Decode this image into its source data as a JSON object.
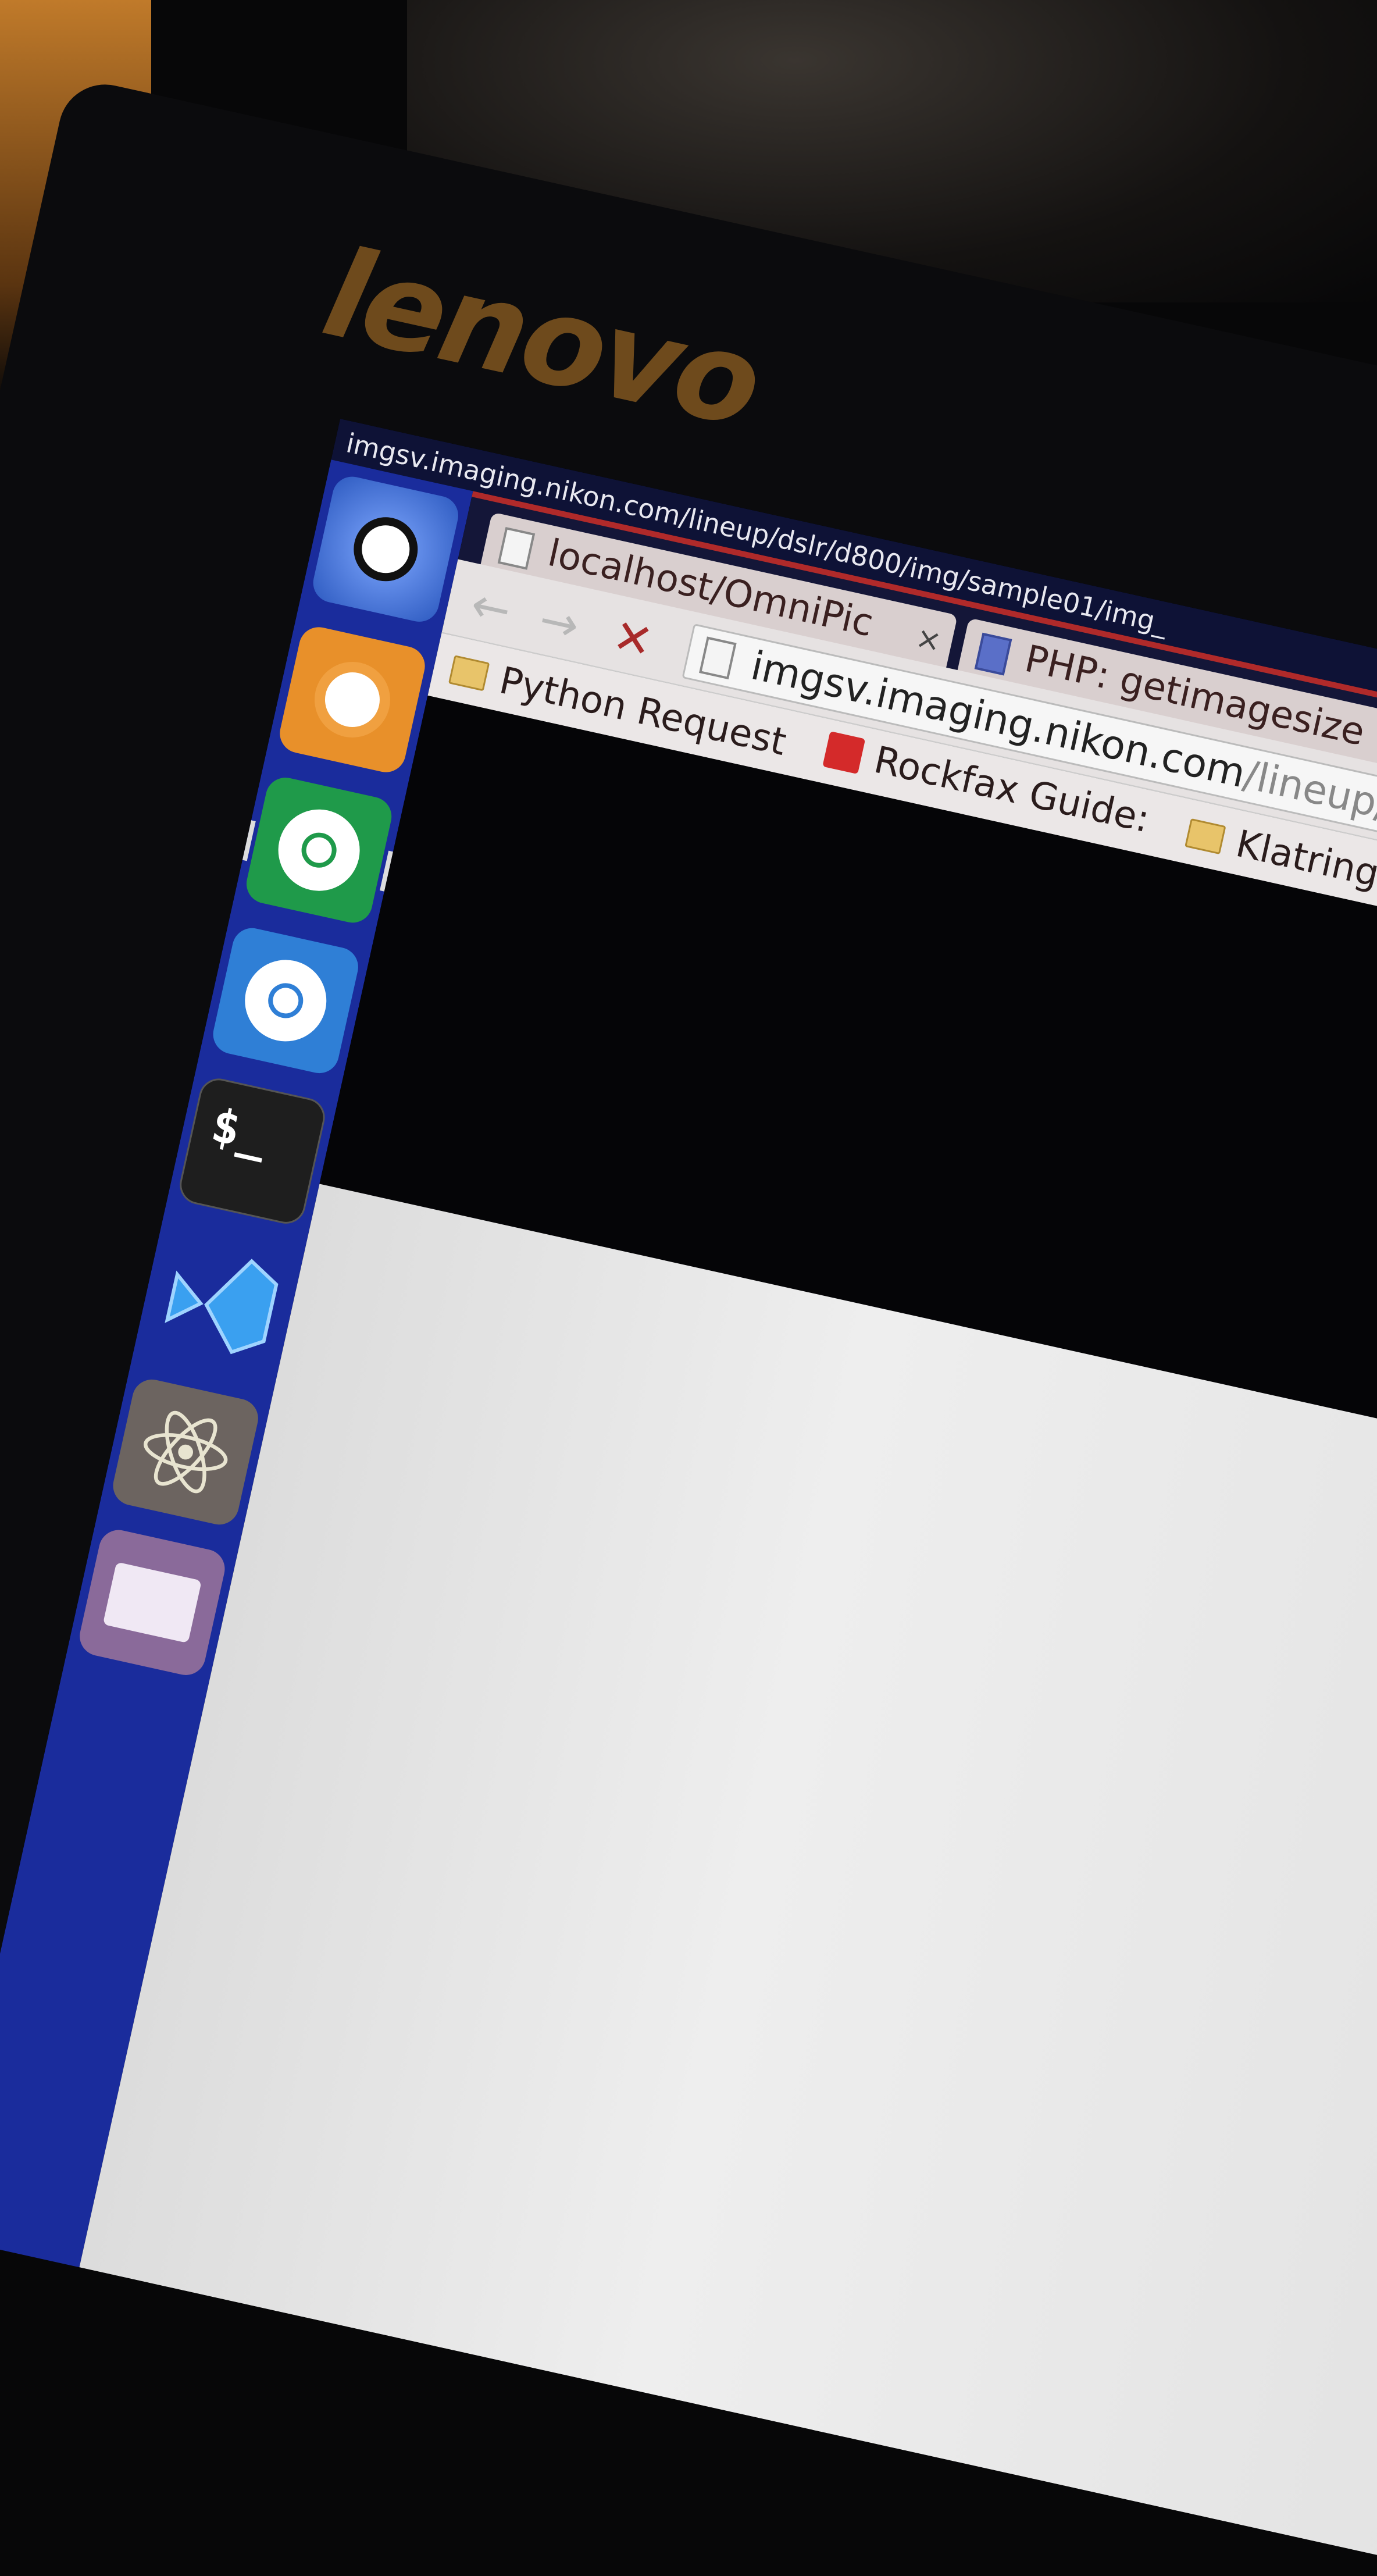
{
  "bezel": {
    "brand": "lenovo"
  },
  "window_title": "imgsv.imaging.nikon.com/lineup/dslr/d800/img/sample01/img_",
  "launcher": {
    "items": [
      {
        "name": "Ubuntu Dash",
        "icon": "ubuntu-logo-icon",
        "color": "#3d6fd0"
      },
      {
        "name": "Firefox",
        "icon": "firefox-icon",
        "color": "#e8902a"
      },
      {
        "name": "Chrome",
        "icon": "chrome-icon",
        "color": "#1f9a4a"
      },
      {
        "name": "Chromium",
        "icon": "chromium-icon",
        "color": "#2f7fd6",
        "active": true
      },
      {
        "name": "Terminal",
        "icon": "terminal-icon",
        "color": "#1e1e1e",
        "glyph": "$_"
      },
      {
        "name": "Visual Studio Code",
        "icon": "vscode-icon",
        "color": "#1a2c9c"
      },
      {
        "name": "Atom",
        "icon": "atom-icon",
        "color": "#6c6460"
      },
      {
        "name": "Files",
        "icon": "folder-icon",
        "color": "#8a6a9a"
      }
    ]
  },
  "tabs": [
    {
      "title": "localhost/OmniPic",
      "close": "×"
    },
    {
      "title": "PHP: getimagesize",
      "close": "×",
      "favicon": "php"
    }
  ],
  "toolbar": {
    "back": "←",
    "forward": "→",
    "stop": "✕"
  },
  "address_bar": {
    "host": "imgsv.imaging.nikon.com",
    "path": "/lineup/d"
  },
  "bookmarks": [
    {
      "label": "Python Request",
      "icon": "folder-icon"
    },
    {
      "label": "Rockfax Guide:",
      "icon": "rockfax-icon"
    },
    {
      "label": "Klatring",
      "icon": "folder-icon"
    }
  ]
}
